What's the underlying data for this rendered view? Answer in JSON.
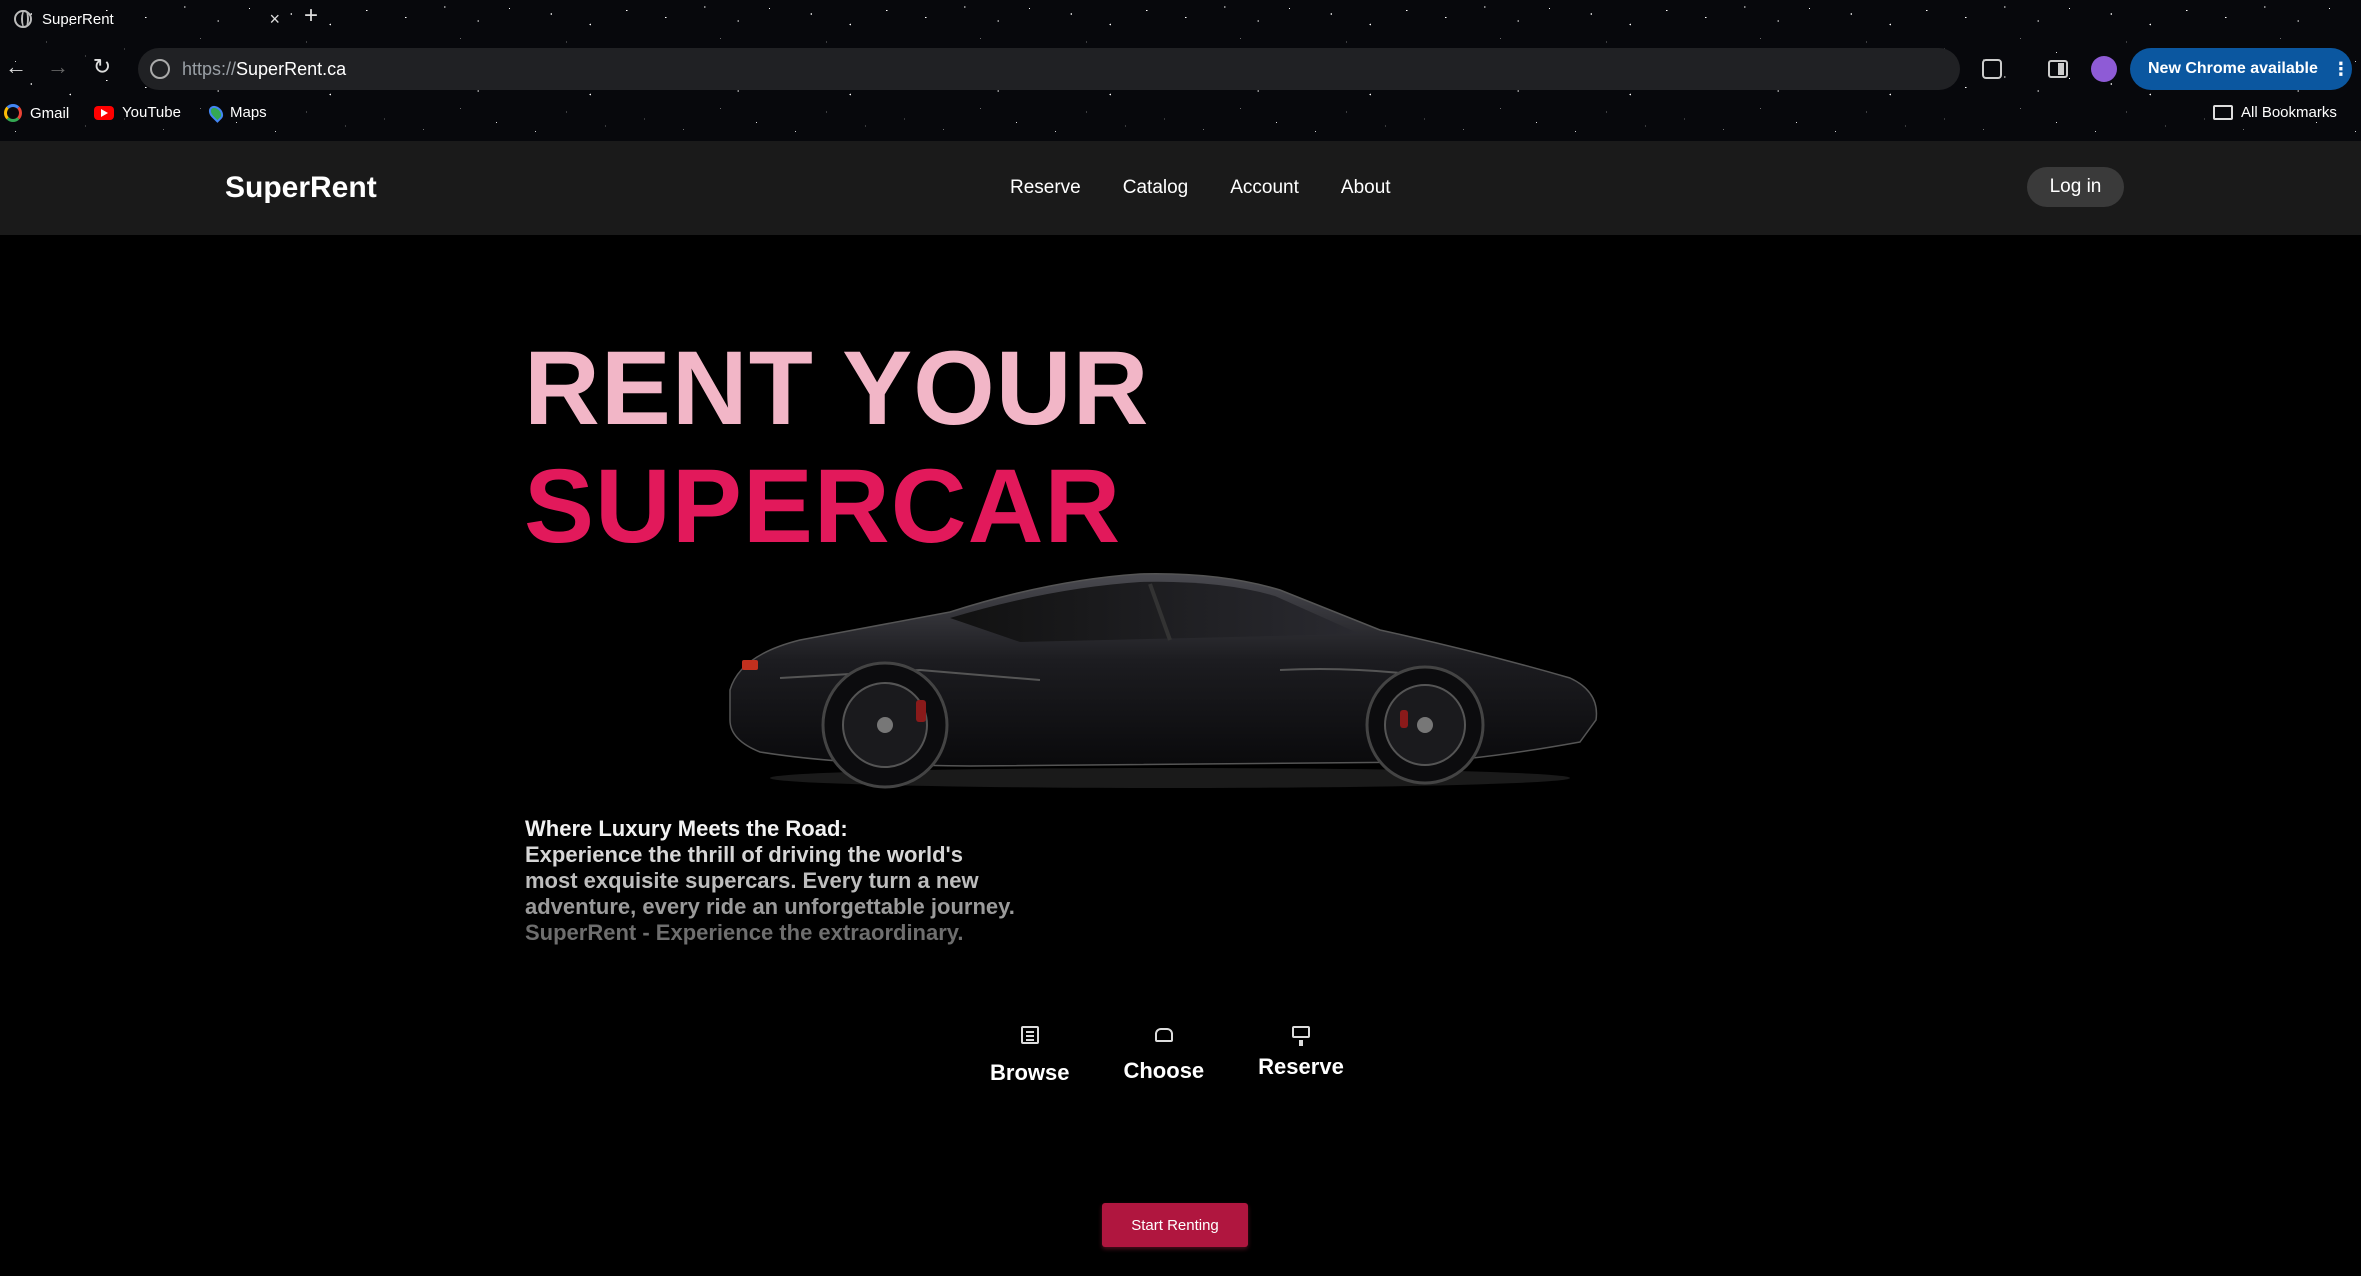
{
  "browser": {
    "tab_title": "SuperRent",
    "tab_close": "×",
    "new_tab": "+",
    "url_scheme": "https://",
    "url_host": "SuperRent.ca",
    "update_label": "New Chrome available",
    "update_menu": "⋮",
    "bookmarks": [
      {
        "label": "Gmail",
        "icon": "gmail-icon"
      },
      {
        "label": "YouTube",
        "icon": "youtube-icon"
      },
      {
        "label": "Maps",
        "icon": "maps-icon"
      }
    ],
    "all_bookmarks": "All Bookmarks"
  },
  "site": {
    "logo": "SuperRent",
    "nav": [
      "Reserve",
      "Catalog",
      "Account",
      "About"
    ],
    "login": "Log in"
  },
  "hero": {
    "line1": "RENT YOUR",
    "line2": "SUPERCAR",
    "line1_color": "#f2b6c7",
    "line2_color": "#e2195b"
  },
  "tagline": {
    "line1": "Where Luxury Meets the Road:",
    "line2": "Experience the thrill of driving the world's",
    "line3": "most exquisite supercars. Every turn a new",
    "line4": "adventure, every ride an unforgettable journey.",
    "line5": "SuperRent - Experience the extraordinary."
  },
  "steps": [
    {
      "label": "Browse",
      "icon": "list-icon"
    },
    {
      "label": "Choose",
      "icon": "car-icon"
    },
    {
      "label": "Reserve",
      "icon": "monitor-icon"
    }
  ],
  "cta": {
    "label": "Start Renting",
    "color": "#b0163f"
  }
}
